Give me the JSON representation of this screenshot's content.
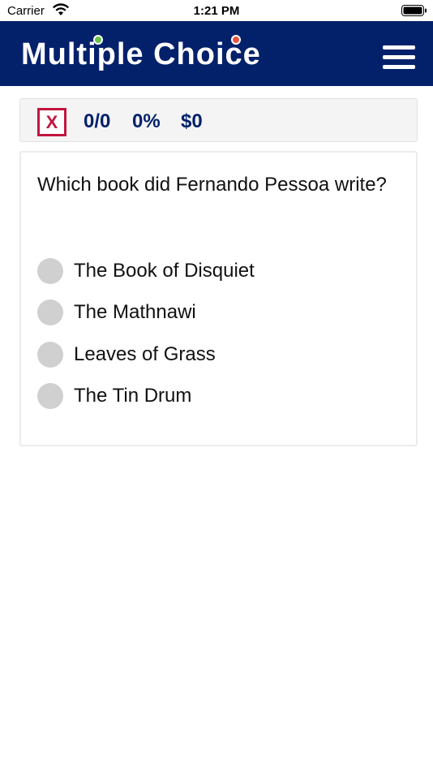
{
  "status_bar": {
    "carrier": "Carrier",
    "time": "1:21 PM",
    "wifi_icon": "wifi-icon",
    "battery_icon": "battery-icon"
  },
  "header": {
    "title": "Multiple Choice",
    "menu_icon": "hamburger-menu-icon",
    "background_color": "#03216b"
  },
  "scorebar": {
    "close_label": "X",
    "count": "0/0",
    "percent": "0%",
    "money": "$0",
    "accent_color": "#c2163f",
    "text_color": "#03216b"
  },
  "quiz": {
    "question": "Which book did Fernando Pessoa write?",
    "options": [
      {
        "label": "The Book of Disquiet",
        "selected": false
      },
      {
        "label": "The Mathnawi",
        "selected": false
      },
      {
        "label": "Leaves of Grass",
        "selected": false
      },
      {
        "label": "The Tin Drum",
        "selected": false
      }
    ]
  }
}
